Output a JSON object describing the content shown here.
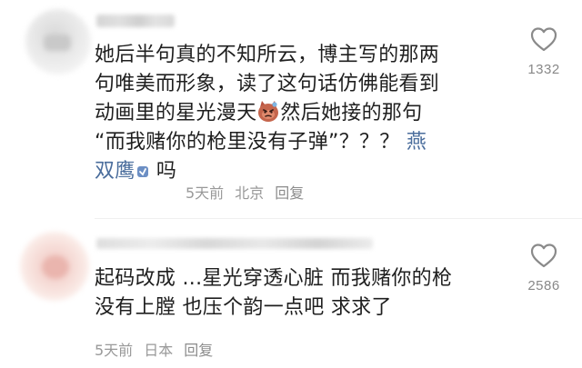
{
  "comments": [
    {
      "lines": [
        "她后半句真的不知所云，博主写的那两",
        "句唯美而形象，读了这句话仿佛能看到",
        "动画里的星光漫天",
        "然后她接的那句",
        "“而我赌你的枪里没有子弹”？？？ ",
        "燕",
        "双鹰",
        " 吗"
      ],
      "emoji": "cat-face-emoji",
      "mention_emoji": "small-sticker-emoji",
      "meta": {
        "time": "5天前",
        "location": "北京",
        "reply": "回复"
      },
      "likes": "1332",
      "like_icon": "heart-icon"
    },
    {
      "lines": [
        "起码改成 ...星光穿透心脏 而我赌你的枪",
        "没有上膛 也压个韵一点吧 求求了"
      ],
      "meta": {
        "time": "5天前",
        "location": "日本",
        "reply": "回复"
      },
      "likes": "2586",
      "like_icon": "heart-icon"
    }
  ],
  "colors": {
    "text": "#1f1f1f",
    "meta": "#999999",
    "mention": "#4a6d9c",
    "icon": "#8a8a8a"
  }
}
